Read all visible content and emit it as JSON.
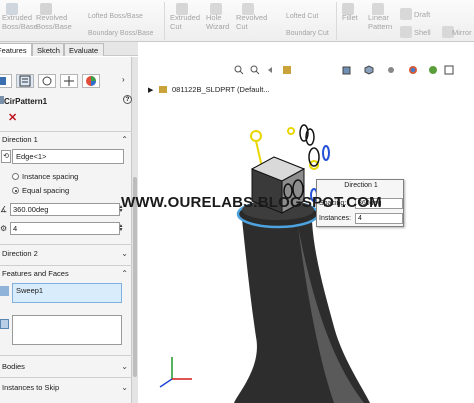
{
  "ribbon": {
    "items": [
      {
        "label": "Extruded",
        "sub": "Boss/Base"
      },
      {
        "label": "Revolved",
        "sub": "Boss/Base"
      },
      {
        "label": "Lofted Boss/Base"
      },
      {
        "label": "Boundary Boss/Base"
      },
      {
        "label": "Extruded",
        "sub": "Cut"
      },
      {
        "label": "Hole",
        "sub": "Wizard"
      },
      {
        "label": "Revolved",
        "sub": "Cut"
      },
      {
        "label": "Lofted Cut"
      },
      {
        "label": "Boundary Cut"
      },
      {
        "label": "Fillet"
      },
      {
        "label": "Linear",
        "sub": "Pattern"
      },
      {
        "label": "Draft"
      },
      {
        "label": "Shell"
      },
      {
        "label": "Mirror"
      }
    ]
  },
  "tabs": [
    "Features",
    "Sketch",
    "Evaluate"
  ],
  "property_manager": {
    "title": "CirPattern1",
    "direction1": {
      "header": "Direction 1",
      "edge": "Edge<1>",
      "options": [
        "Instance spacing",
        "Equal spacing"
      ],
      "selected_option": "Equal spacing",
      "angle": "360.00deg",
      "count": "4"
    },
    "direction2": {
      "header": "Direction 2"
    },
    "features_and_faces": {
      "header": "Features and Faces",
      "selected": "Sweep1"
    },
    "bodies": {
      "header": "Bodies"
    },
    "instances_to_skip": {
      "header": "Instances to Skip"
    }
  },
  "graphics": {
    "tree_label": "081122B_SLDPRT (Default...",
    "callout": {
      "title": "Direction 1",
      "spacing_label": "Spacing:",
      "spacing_value": "360deg",
      "instances_label": "Instances:",
      "instances_value": "4"
    },
    "watermark": "WWW.OURELABS.BLOGSPOT.COM"
  }
}
